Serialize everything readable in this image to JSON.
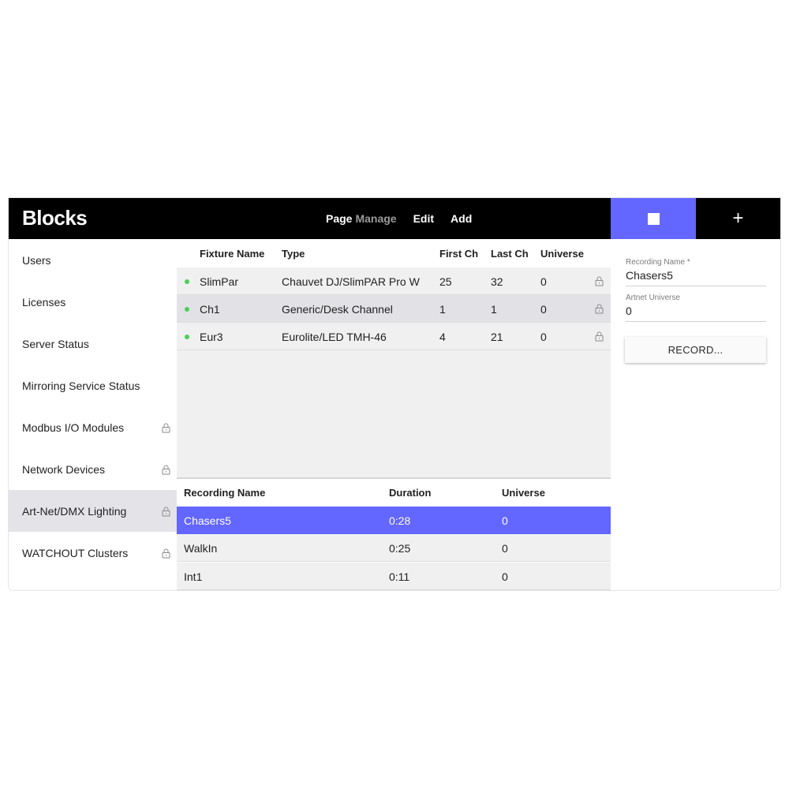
{
  "app": {
    "logo": "Blocks"
  },
  "nav": {
    "page_label": "Page",
    "page_value": "Manage",
    "edit": "Edit",
    "add": "Add",
    "plus": "+"
  },
  "sidebar": {
    "items": [
      {
        "label": "Users",
        "locked": false,
        "active": false
      },
      {
        "label": "Licenses",
        "locked": false,
        "active": false
      },
      {
        "label": "Server Status",
        "locked": false,
        "active": false
      },
      {
        "label": "Mirroring Service Status",
        "locked": false,
        "active": false
      },
      {
        "label": "Modbus I/O Modules",
        "locked": true,
        "active": false
      },
      {
        "label": "Network Devices",
        "locked": true,
        "active": false
      },
      {
        "label": "Art-Net/DMX Lighting",
        "locked": true,
        "active": true
      },
      {
        "label": "WATCHOUT Clusters",
        "locked": true,
        "active": false
      }
    ]
  },
  "fixtures": {
    "headers": {
      "name": "Fixture Name",
      "type": "Type",
      "first": "First Ch",
      "last": "Last Ch",
      "universe": "Universe"
    },
    "rows": [
      {
        "name": "SlimPar",
        "type": "Chauvet DJ/SlimPAR Pro W",
        "first": "25",
        "last": "32",
        "universe": "0"
      },
      {
        "name": "Ch1",
        "type": "Generic/Desk Channel",
        "first": "1",
        "last": "1",
        "universe": "0"
      },
      {
        "name": "Eur3",
        "type": "Eurolite/LED TMH-46",
        "first": "4",
        "last": "21",
        "universe": "0"
      }
    ]
  },
  "recordings": {
    "headers": {
      "name": "Recording Name",
      "duration": "Duration",
      "universe": "Universe"
    },
    "rows": [
      {
        "name": "Chasers5",
        "duration": "0:28",
        "universe": "0",
        "selected": true
      },
      {
        "name": "WalkIn",
        "duration": "0:25",
        "universe": "0",
        "selected": false
      },
      {
        "name": "Int1",
        "duration": "0:11",
        "universe": "0",
        "selected": false
      }
    ]
  },
  "panel": {
    "recording_name_label": "Recording Name *",
    "recording_name_value": "Chasers5",
    "artnet_universe_label": "Artnet Universe",
    "artnet_universe_value": "0",
    "record_button": "RECORD..."
  },
  "colors": {
    "accent": "#6366ff",
    "status_dot": "#4ccf5c",
    "header_bg": "#000000"
  }
}
